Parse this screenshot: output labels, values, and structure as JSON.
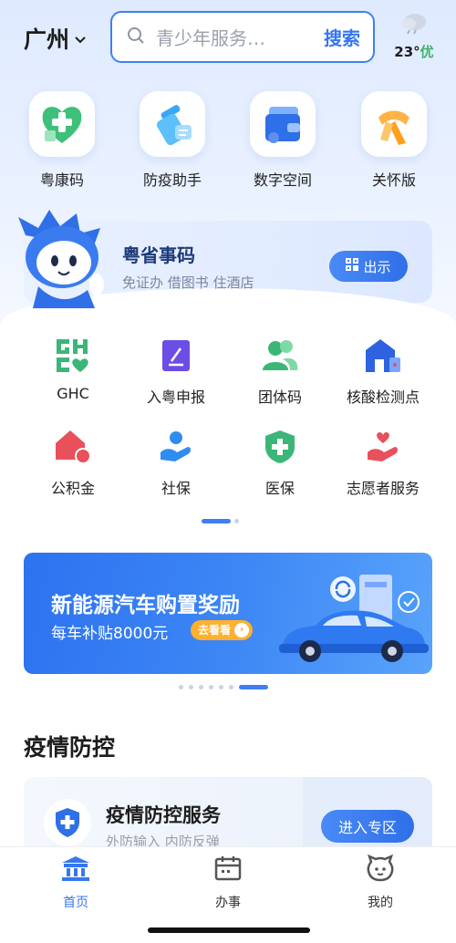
{
  "header": {
    "city": "广州",
    "search_placeholder": "青少年服务…",
    "search_button": "搜索",
    "weather_temp": "23°",
    "weather_quality": "优"
  },
  "quick_actions": [
    {
      "label": "粤康码",
      "icon": "health-code-icon"
    },
    {
      "label": "防疫助手",
      "icon": "spray-icon"
    },
    {
      "label": "数字空间",
      "icon": "wallet-icon"
    },
    {
      "label": "关怀版",
      "icon": "scarf-icon"
    }
  ],
  "yue_code": {
    "title": "粤省事码",
    "subtitle": "免证办 借图书 住酒店",
    "button": "出示"
  },
  "services": [
    {
      "label": "GHC",
      "icon": "ghc-icon"
    },
    {
      "label": "入粤申报",
      "icon": "declaration-icon"
    },
    {
      "label": "团体码",
      "icon": "group-icon"
    },
    {
      "label": "核酸检测点",
      "icon": "testing-site-icon"
    },
    {
      "label": "公积金",
      "icon": "housing-fund-icon"
    },
    {
      "label": "社保",
      "icon": "social-security-icon"
    },
    {
      "label": "医保",
      "icon": "medical-insurance-icon"
    },
    {
      "label": "志愿者服务",
      "icon": "volunteer-icon"
    }
  ],
  "promo": {
    "title": "新能源汽车购置奖励",
    "subtitle": "每车补贴8000元",
    "cta": "去看看"
  },
  "section": {
    "title": "疫情防控"
  },
  "service_card": {
    "title": "疫情防控服务",
    "subtitle": "外防输入 内防反弹",
    "button": "进入专区"
  },
  "tabs": [
    {
      "label": "首页",
      "active": true
    },
    {
      "label": "办事",
      "active": false
    },
    {
      "label": "我的",
      "active": false
    }
  ],
  "colors": {
    "accent": "#3677f0",
    "green": "#3db36b",
    "red": "#e8505b"
  }
}
